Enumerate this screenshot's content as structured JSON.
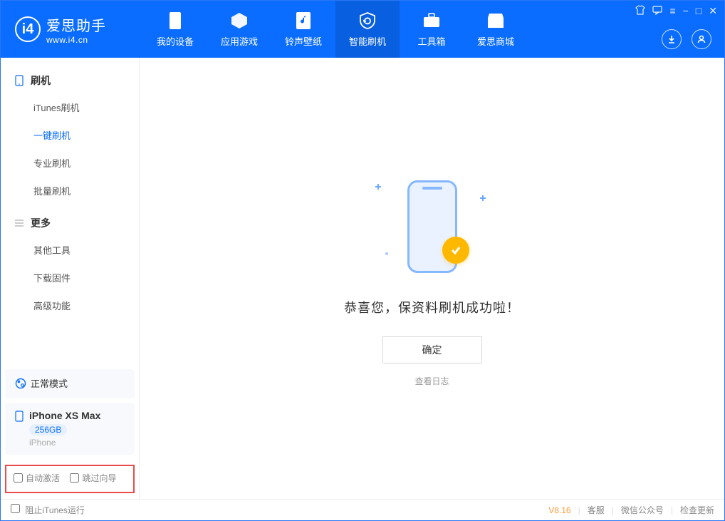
{
  "app": {
    "title": "爱思助手",
    "subtitle": "www.i4.cn"
  },
  "header_tabs": [
    {
      "label": "我的设备"
    },
    {
      "label": "应用游戏"
    },
    {
      "label": "铃声壁纸"
    },
    {
      "label": "智能刷机"
    },
    {
      "label": "工具箱"
    },
    {
      "label": "爱思商城"
    }
  ],
  "sidebar": {
    "group1": {
      "title": "刷机",
      "items": [
        "iTunes刷机",
        "一键刷机",
        "专业刷机",
        "批量刷机"
      ],
      "active_index": 1
    },
    "group2": {
      "title": "更多",
      "items": [
        "其他工具",
        "下载固件",
        "高级功能"
      ]
    }
  },
  "device": {
    "mode_label": "正常模式",
    "name": "iPhone XS Max",
    "capacity": "256GB",
    "type": "iPhone"
  },
  "bottom_options": {
    "opt1": "自动激活",
    "opt2": "跳过向导"
  },
  "main": {
    "success_text": "恭喜您，保资料刷机成功啦！",
    "confirm_label": "确定",
    "log_link": "查看日志"
  },
  "footer": {
    "block_itunes": "阻止iTunes运行",
    "version": "V8.16",
    "links": [
      "客服",
      "微信公众号",
      "检查更新"
    ]
  }
}
